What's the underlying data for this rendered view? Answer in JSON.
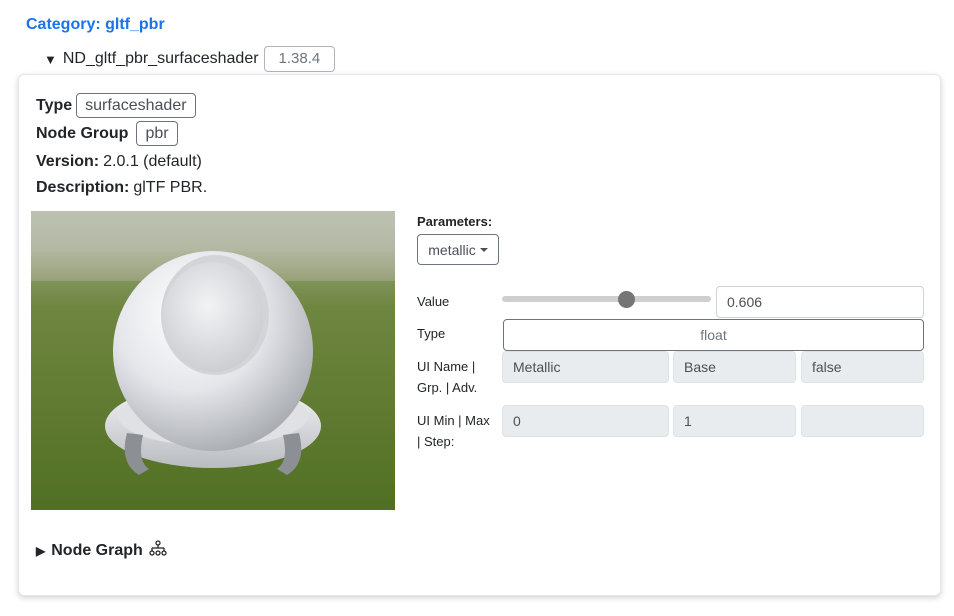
{
  "category": {
    "title": "Category: gltf_pbr"
  },
  "node": {
    "expand_icon": "triangle-down-icon",
    "name": "ND_gltf_pbr_surfaceshader",
    "version_badge": "1.38.4"
  },
  "details": {
    "type_label": "Type",
    "type_value": "surfaceshader",
    "node_group_label": "Node Group",
    "node_group_value": "pbr",
    "version_label": "Version:",
    "version_value": "2.0.1 (default)",
    "description_label": "Description:",
    "description_value": "glTF PBR."
  },
  "preview": {
    "image": "shaded-sphere-on-grass-preview"
  },
  "parameters": {
    "label": "Parameters:",
    "selected": "metallic",
    "value_label": "Value",
    "value": "0.606",
    "slider_fraction": 0.606,
    "type_label": "Type",
    "type_value": "float",
    "ui_name_label_1": "UI Name |",
    "ui_name_label_2": "Grp. | Adv.",
    "ui_name": "Metallic",
    "ui_group": "Base",
    "ui_advanced": "false",
    "ui_min_label_1": "UI Min | Max",
    "ui_min_label_2": "| Step:",
    "ui_min": "0",
    "ui_max": "1",
    "ui_step": ""
  },
  "node_graph": {
    "label": "Node Graph",
    "icon": "node-graph-icon",
    "expand_icon": "triangle-right-icon"
  }
}
